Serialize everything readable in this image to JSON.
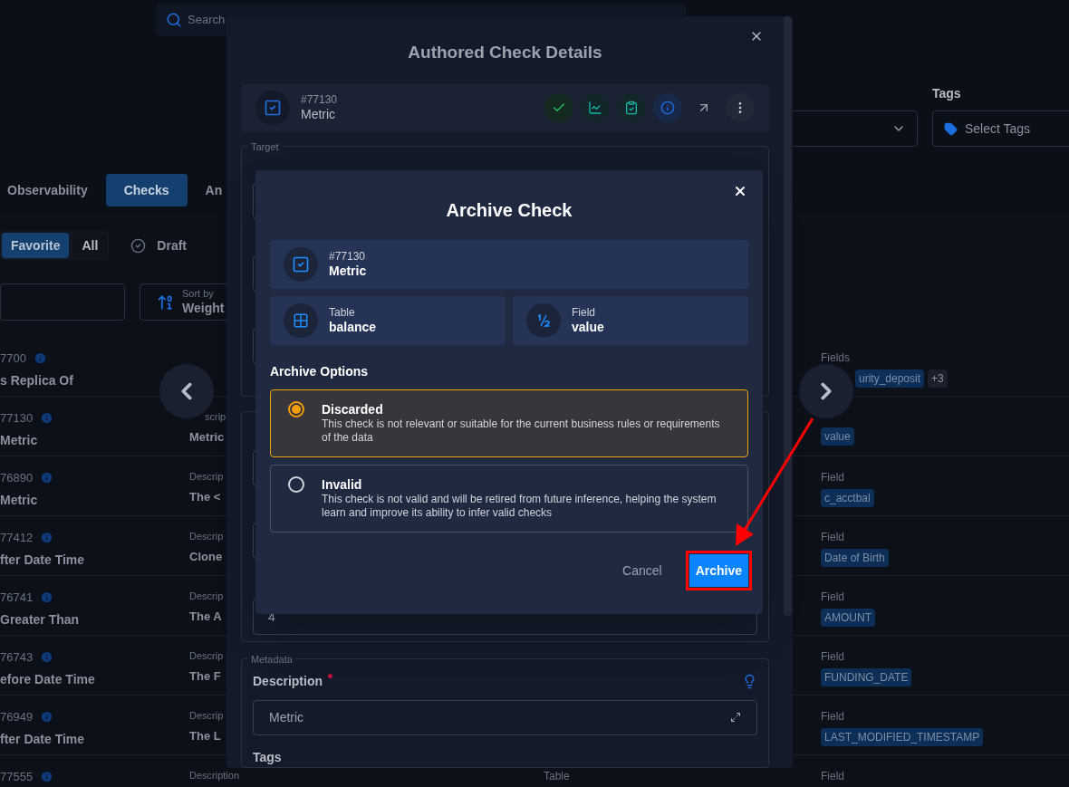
{
  "background": {
    "search": {
      "placeholder": "Search"
    },
    "tags": {
      "label": "Tags",
      "placeholder": "Select Tags"
    },
    "tabs": [
      {
        "label": "Observability",
        "selected": false
      },
      {
        "label": "Checks",
        "selected": true
      },
      {
        "label": "An",
        "selected": false
      }
    ],
    "filters": [
      {
        "label": "Favorite",
        "selected": true
      },
      {
        "label": "All",
        "selected": false
      }
    ],
    "draft": "Draft",
    "sort": {
      "label": "Sort by",
      "value": "Weight"
    },
    "rows": [
      {
        "id": "7700",
        "name": "s Replica Of",
        "fields_label": "Fields",
        "fields": [
          "urity_deposit"
        ],
        "more": "+3"
      },
      {
        "id": "77130",
        "name": "Metric",
        "description_label": "scrip",
        "description": "Metric",
        "fields": [
          "value"
        ]
      },
      {
        "id": "76890",
        "name": "Metric",
        "description_label": "Descrip",
        "description": "The <",
        "fields_label": "Field",
        "fields": [
          "c_acctbal"
        ]
      },
      {
        "id": "77412",
        "name": "fter Date Time",
        "description_label": "Descrip",
        "description": "Clone",
        "fields_label": "Field",
        "fields": [
          "Date of Birth"
        ]
      },
      {
        "id": "76741",
        "name": "Greater Than",
        "description_label": "Descrip",
        "description": "The A",
        "fields_label": "Field",
        "fields": [
          "AMOUNT"
        ]
      },
      {
        "id": "76743",
        "name": "efore Date Time",
        "description_label": "Descrip",
        "description": "The F",
        "fields_label": "Field",
        "fields": [
          "FUNDING_DATE"
        ]
      },
      {
        "id": "76949",
        "name": "fter Date Time",
        "description_label": "Descrip",
        "description": "The L",
        "fields_label": "Field",
        "fields": [
          "LAST_MODIFIED_TIMESTAMP"
        ]
      },
      {
        "id": "77555",
        "description_label": "Description",
        "table_label": "Table",
        "fields_label": "Field"
      }
    ]
  },
  "details": {
    "title": "Authored Check Details",
    "check": {
      "id": "#77130",
      "name": "Metric"
    },
    "actions": [
      {
        "kind": "check"
      },
      {
        "kind": "chart"
      },
      {
        "kind": "clipboard"
      },
      {
        "kind": "info"
      },
      {
        "kind": "arrow"
      },
      {
        "kind": "more"
      }
    ],
    "target_legend": "Target",
    "value": "4",
    "metadata_legend": "Metadata",
    "description": {
      "label": "Description",
      "required": true,
      "value": "Metric"
    },
    "tags_label": "Tags"
  },
  "archive": {
    "title": "Archive Check",
    "check": {
      "id": "#77130",
      "name": "Metric"
    },
    "table": {
      "label": "Table",
      "value": "balance"
    },
    "field": {
      "label": "Field",
      "value": "value"
    },
    "options_title": "Archive Options",
    "options": [
      {
        "label": "Discarded",
        "description": "This check is not relevant or suitable for the current business rules or requirements of the data",
        "selected": true
      },
      {
        "label": "Invalid",
        "description": "This check is not valid and will be retired from future inference, helping the system learn and improve its ability to infer valid checks",
        "selected": false
      }
    ],
    "cancel": "Cancel",
    "confirm": "Archive"
  }
}
